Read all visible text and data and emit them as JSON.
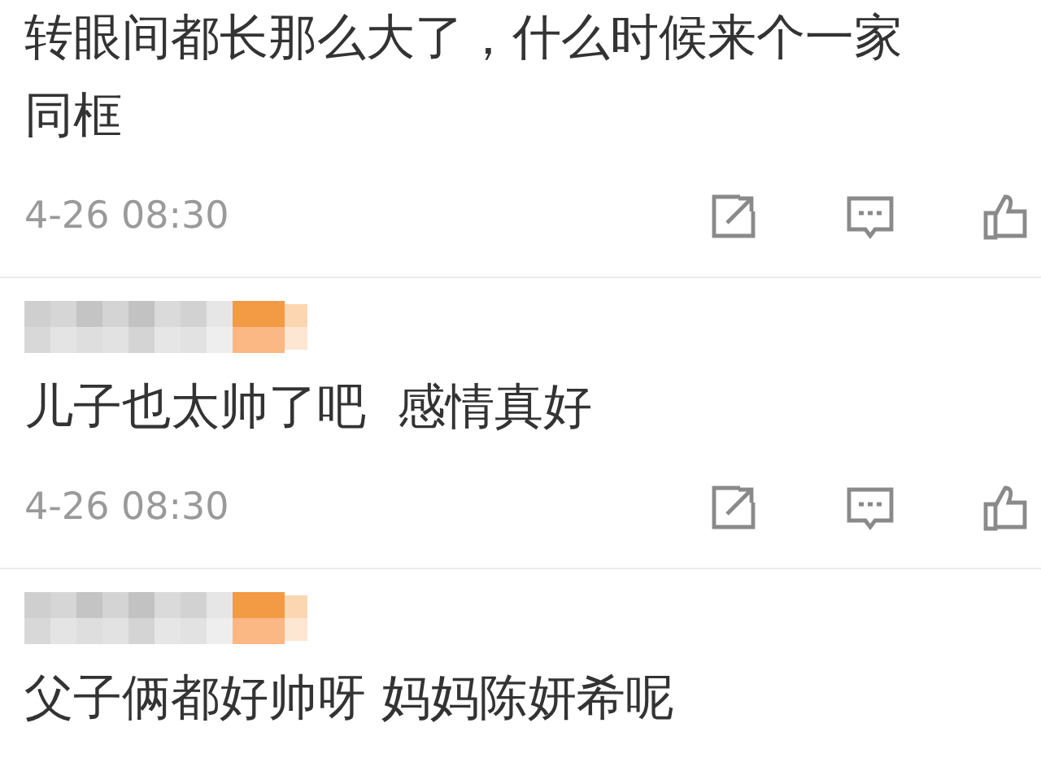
{
  "comments": [
    {
      "author_blurred": false,
      "lines": [
        "转眼间都长那么大了，什么时候来个一家",
        "同框"
      ],
      "time": "4-26 08:30"
    },
    {
      "author_blurred": true,
      "lines": [
        "儿子也太帅了吧  感情真好"
      ],
      "time": "4-26 08:30"
    },
    {
      "author_blurred": true,
      "lines": [
        "父子俩都好帅呀 妈妈陈妍希呢"
      ]
    }
  ]
}
